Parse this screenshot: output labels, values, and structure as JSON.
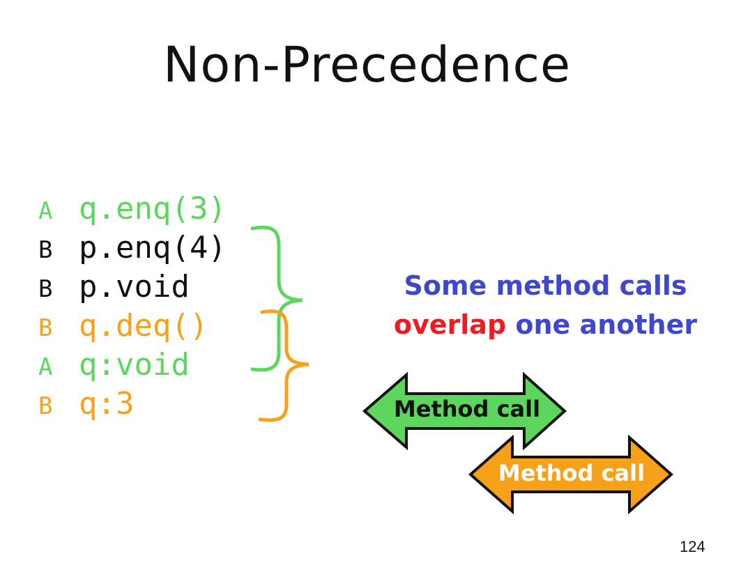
{
  "slide": {
    "title": "Non-Precedence",
    "page_number": "124"
  },
  "history": {
    "lines": [
      {
        "thread": "A",
        "call": "q.enq(3)",
        "color": "#5cd65c"
      },
      {
        "thread": "B",
        "call": "p.enq(4)",
        "color": "#111111"
      },
      {
        "thread": "B",
        "call": "p.void",
        "color": "#111111"
      },
      {
        "thread": "B",
        "call": "q.deq()",
        "color": "#f7a11a"
      },
      {
        "thread": "A",
        "call": "q:void",
        "color": "#5cd65c"
      },
      {
        "thread": "B",
        "call": "q:3",
        "color": "#f7a11a"
      }
    ]
  },
  "caption": {
    "line1": "Some method calls",
    "line2_highlight": "overlap",
    "line2_rest": "one another",
    "colors": {
      "blue": "#3f48cc",
      "red": "#ed1c24"
    }
  },
  "arrows": {
    "green": {
      "label": "Method call",
      "color": "#5cd65c"
    },
    "orange": {
      "label": "Method call",
      "color": "#f7a11a"
    }
  }
}
